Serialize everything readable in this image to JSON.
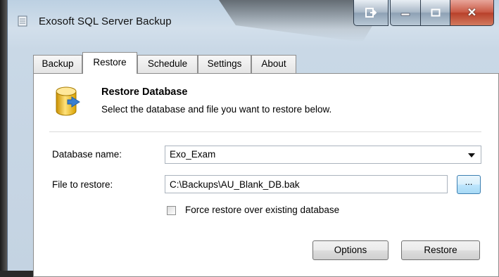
{
  "window": {
    "title": "Exosoft SQL Server Backup"
  },
  "tabs": [
    {
      "label": "Backup"
    },
    {
      "label": "Restore"
    },
    {
      "label": "Schedule"
    },
    {
      "label": "Settings"
    },
    {
      "label": "About"
    }
  ],
  "active_tab": "Restore",
  "panel": {
    "heading": "Restore Database",
    "subheading": "Select the database and file you want to restore below."
  },
  "form": {
    "database_name_label": "Database name:",
    "database_name_value": "Exo_Exam",
    "file_label": "File to restore:",
    "file_value": "C:\\Backups\\AU_Blank_DB.bak",
    "browse_label": "...",
    "force_restore_label": "Force restore over existing database",
    "force_restore_checked": false
  },
  "buttons": {
    "options": "Options",
    "restore": "Restore"
  },
  "icons": {
    "app": "database-app-icon",
    "restore": "database-restore-icon",
    "caption_extra": "dock-arrow-icon",
    "minimize": "minimize-icon",
    "maximize": "maximize-icon",
    "close": "close-icon"
  },
  "colors": {
    "icon_gold": "#f2c21b",
    "icon_arrow": "#3a7fd0",
    "close_red": "#c95a45"
  }
}
